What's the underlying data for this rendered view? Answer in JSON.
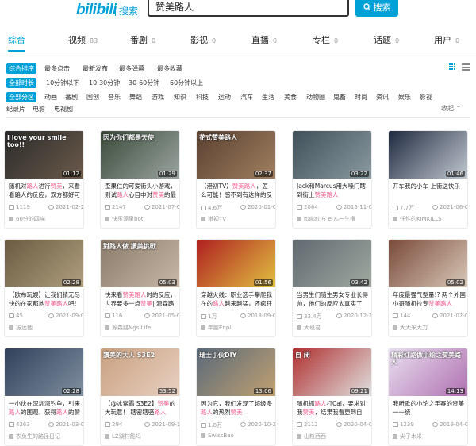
{
  "header": {
    "logo_text": "bilibili",
    "logo_sub": "搜索",
    "search_value": "赞美路人",
    "search_button": "搜索"
  },
  "tabs": [
    {
      "label": "综合",
      "count": ""
    },
    {
      "label": "视频",
      "count": "83"
    },
    {
      "label": "番剧",
      "count": "0"
    },
    {
      "label": "影视",
      "count": "0"
    },
    {
      "label": "直播",
      "count": "0"
    },
    {
      "label": "专栏",
      "count": "0"
    },
    {
      "label": "话题",
      "count": "0"
    },
    {
      "label": "用户",
      "count": "0"
    }
  ],
  "filters": {
    "sort": {
      "selected": "综合排序",
      "options": [
        "最多点击",
        "最新发布",
        "最多弹幕",
        "最多收藏"
      ]
    },
    "duration": {
      "selected": "全部时长",
      "options": [
        "10分钟以下",
        "10-30分钟",
        "30-60分钟",
        "60分钟以上"
      ]
    },
    "zone": {
      "selected": "全部分区",
      "options": [
        "动画",
        "番剧",
        "国创",
        "音乐",
        "舞蹈",
        "游戏",
        "知识",
        "科技",
        "运动",
        "汽车",
        "生活",
        "美食",
        "动物圈",
        "鬼畜",
        "时尚",
        "资讯",
        "娱乐",
        "影视"
      ],
      "options2": [
        "纪录片",
        "电影",
        "电视剧"
      ]
    },
    "collapse": "收起"
  },
  "videos": [
    {
      "duration": "01:12",
      "caption": "I love your smile too!!",
      "title_a": "随机对",
      "title_hl": "路人",
      "title_b": "进行",
      "title_hl2": "赞美",
      "title_c": "，来看看路人的反应，双方都好可",
      "views": "1119",
      "date": "2021-02-23",
      "uploader": "60分的四喵",
      "color1": "#2b2b2b",
      "color2": "#6b5a4a"
    },
    {
      "duration": "01:29",
      "caption": "因为你们都是天使",
      "title_a": "歪果仁的可爱街头小游戏，则试",
      "title_hl": "路人",
      "title_b": "心目中对",
      "title_hl2": "赞美",
      "title_c": "的最好回答",
      "views": "2147",
      "date": "2021-07-09",
      "uploader": "快乐源泉bot",
      "color1": "#3a4a3a",
      "color2": "#9aa5a0"
    },
    {
      "duration": "02:37",
      "caption": "花式赞美路人",
      "title_a": "【港初TV】",
      "title_hl": "赞美路人",
      "title_b": "，怎么可能！感不到有这样的反转",
      "title_hl2": "",
      "title_c": "",
      "views": "4.6万",
      "date": "2020-01-03",
      "uploader": "港初TV",
      "color1": "#5a4030",
      "color2": "#a08060"
    },
    {
      "duration": "03:22",
      "caption": "",
      "title_a": "Jack和Marcus用大嗓门瞎到街上",
      "title_hl": "赞美路人",
      "title_b": "",
      "title_hl2": "",
      "title_c": "",
      "views": "2064",
      "date": "2015-11-09",
      "uploader": "itakai ち e ん一生撸",
      "color1": "#40505a",
      "color2": "#8a9aa0"
    },
    {
      "duration": "01:46",
      "caption": "",
      "title_a": "开车我的小车 上街送快乐",
      "title_hl": "",
      "title_b": "",
      "title_hl2": "",
      "title_c": "",
      "views": "7.7万",
      "date": "2021-06-03",
      "uploader": "任性的KIMKILLS",
      "color1": "#202a40",
      "color2": "#c0c8d0"
    },
    {
      "duration": "02:28",
      "caption": "",
      "title_a": "【欧布玩娱】让我们猜无尽快的在家都地",
      "title_hl": "赞美路人",
      "title_b": "吧!",
      "title_hl2": "",
      "title_c": "",
      "views": "45",
      "date": "2021-09-08",
      "uploader": "振远他",
      "color1": "#6a5a40",
      "color2": "#b0a080"
    },
    {
      "duration": "05:03",
      "caption": "對路人做 讚美挑戰",
      "title_a": "快来看",
      "title_hl": "赞美路人",
      "title_b": "时的反应，世界要多一点",
      "title_hl2": "赞美",
      "title_c": "| 源森路",
      "views": "116",
      "date": "2021-05-02",
      "uploader": "源森路Ngs Life",
      "color1": "#8a7a6a",
      "color2": "#c8b8a8"
    },
    {
      "duration": "01:56",
      "caption": "",
      "title_a": "穿越火线：职业选手攀爬我在的",
      "title_hl": "路人",
      "title_b": "越来越猛，还疯狂",
      "title_hl2": "",
      "title_c": "",
      "views": "1万",
      "date": "2018-09-02",
      "uploader": "年鹏Enpl",
      "color1": "#b02020",
      "color2": "#e0c040"
    },
    {
      "duration": "03:42",
      "caption": "",
      "title_a": "当男生们随生男女专业长得帅，他们的反应太真实了",
      "title_hl": "",
      "title_b": "",
      "title_hl2": "",
      "title_c": "",
      "views": "33.4万",
      "date": "2020-12-28",
      "uploader": "大班君",
      "color1": "#606a70",
      "color2": "#a0a8a0"
    },
    {
      "duration": "05:02",
      "caption": "",
      "title_a": "年度最强气型量!? 两个外国小哥随机拉专",
      "title_hl": "赞美路人",
      "title_b": "",
      "title_hl2": "",
      "title_c": "",
      "views": "144",
      "date": "2021-02-09",
      "uploader": "大大米大力",
      "color1": "#7a4a3a",
      "color2": "#d8c8b8"
    },
    {
      "duration": "02:28",
      "caption": "",
      "title_a": "一小伙在深圳湾钓鱼，引来",
      "title_hl": "路人",
      "title_b": "的围观，获得",
      "title_hl2": "路人",
      "title_c": "的赞",
      "views": "4263",
      "date": "2021-03-05",
      "uploader": "农负生的路径日记",
      "color1": "#30405a",
      "color2": "#8090a0"
    },
    {
      "duration": "53:52",
      "caption": "讚美的大人 S3E2",
      "title_a": "【@冰紫霜 S3E2】",
      "title_hl": "赞美",
      "title_b": "的大玩意！ 瞎密瞎骚",
      "title_hl2": "路人",
      "title_c": "",
      "views": "294",
      "date": "2021-09-12",
      "uploader": "LZ湖村能吗",
      "color1": "#c8a080",
      "color2": "#e8d0c0"
    },
    {
      "duration": "13:06",
      "caption": "瑞士小伙DIY",
      "title_a": "因为它，我们发现了超级多",
      "title_hl": "路人",
      "title_b": "的热烈",
      "title_hl2": "赞美",
      "title_c": "",
      "views": "1.8万",
      "date": "2020-10-23",
      "uploader": "SwissBao",
      "color1": "#5a6a7a",
      "color2": "#c0a070"
    },
    {
      "duration": "09:21",
      "caption": "自 闭",
      "title_a": "随机抓",
      "title_hl": "路人",
      "title_b": "打Cal，要求对我",
      "title_hl2": "赞美",
      "title_c": "，结果我看更到自闭！",
      "views": "2112",
      "date": "2020-04-04",
      "uploader": "山粒西西",
      "color1": "#b03030",
      "color2": "#e0e0e0"
    },
    {
      "duration": "14:13",
      "caption": "精彩红路做小绘之赞美路人",
      "title_a": "我听歌的小论之手赛的资美一一统",
      "title_hl": "",
      "title_b": "",
      "title_hl2": "",
      "title_c": "",
      "views": "1239",
      "date": "2019-04-09",
      "uploader": "尖子木米",
      "color1": "#e8e0f0",
      "color2": "#b070b0"
    }
  ]
}
